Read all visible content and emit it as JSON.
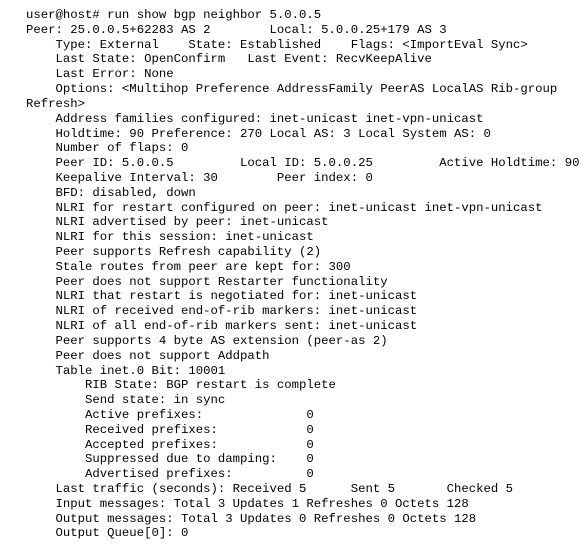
{
  "terminal": {
    "background_color": "#ffffff",
    "foreground_color": "#000000",
    "prompt": "user@host#",
    "command": "run show bgp neighbor 5.0.0.5",
    "command_line": "user@host# run show bgp neighbor 5.0.0.5",
    "columns": 79,
    "rows": 37
  },
  "output": {
    "peer_address": "25.0.0.5",
    "peer_port": "62283",
    "peer_as": "2",
    "local_address": "5.0.0.25",
    "local_port": "179",
    "local_as": "3",
    "type": "External",
    "state": "Established",
    "flags": "<ImportEval Sync>",
    "last_state": "OpenConfirm",
    "last_event": "RecvKeepAlive",
    "last_error": "None",
    "options": "<Multihop Preference AddressFamily PeerAS LocalAS Rib-group Refresh>",
    "address_families_configured": "inet-unicast inet-vpn-unicast",
    "holdtime": "90",
    "preference": "270",
    "local_as_value": "3",
    "local_system_as": "0",
    "number_of_flaps": "0",
    "peer_id": "5.0.0.5",
    "local_id": "5.0.0.25",
    "active_holdtime": "90",
    "keepalive_interval": "30",
    "peer_index": "0",
    "bfd": "disabled, down",
    "nlri_restart_configured": "inet-unicast inet-vpn-unicast",
    "nlri_advertised_by_peer": "inet-unicast",
    "nlri_this_session": "inet-unicast",
    "refresh_capability": "(2)",
    "stale_routes_kept_for": "300",
    "restarter_support": "Peer does not support Restarter functionality",
    "nlri_restart_negotiated": "inet-unicast",
    "nlri_received_eor": "inet-unicast",
    "nlri_all_eor_sent": "inet-unicast",
    "four_byte_as": "(peer-as 2)",
    "addpath_support": "Peer does not support Addpath",
    "table_name": "inet.0",
    "table_bit": "10001",
    "rib_state": "BGP restart is complete",
    "send_state": "in sync",
    "active_prefixes": "0",
    "received_prefixes": "0",
    "accepted_prefixes": "0",
    "suppressed_due_to_damping": "0",
    "advertised_prefixes": "0",
    "last_traffic_received": "5",
    "last_traffic_sent": "5",
    "last_traffic_checked": "5",
    "input_total": "3",
    "input_updates": "1",
    "input_refreshes": "0",
    "input_octets": "128",
    "output_total": "3",
    "output_updates": "0",
    "output_refreshes": "0",
    "output_octets": "128",
    "output_queue_index": "0",
    "output_queue_value": "0"
  },
  "lines": [
    "user@host# run show bgp neighbor 5.0.0.5",
    "Peer: 25.0.0.5+62283 AS 2        Local: 5.0.0.25+179 AS 3",
    "    Type: External    State: Established    Flags: <ImportEval Sync>",
    "    Last State: OpenConfirm   Last Event: RecvKeepAlive",
    "    Last Error: None",
    "    Options: <Multihop Preference AddressFamily PeerAS LocalAS Rib-group",
    "Refresh>",
    "    Address families configured: inet-unicast inet-vpn-unicast",
    "    Holdtime: 90 Preference: 270 Local AS: 3 Local System AS: 0",
    "    Number of flaps: 0",
    "    Peer ID: 5.0.0.5         Local ID: 5.0.0.25         Active Holdtime: 90",
    "    Keepalive Interval: 30        Peer index: 0",
    "    BFD: disabled, down",
    "    NLRI for restart configured on peer: inet-unicast inet-vpn-unicast",
    "    NLRI advertised by peer: inet-unicast",
    "    NLRI for this session: inet-unicast",
    "    Peer supports Refresh capability (2)",
    "    Stale routes from peer are kept for: 300",
    "    Peer does not support Restarter functionality",
    "    NLRI that restart is negotiated for: inet-unicast",
    "    NLRI of received end-of-rib markers: inet-unicast",
    "    NLRI of all end-of-rib markers sent: inet-unicast",
    "    Peer supports 4 byte AS extension (peer-as 2)",
    "    Peer does not support Addpath",
    "    Table inet.0 Bit: 10001",
    "        RIB State: BGP restart is complete",
    "        Send state: in sync",
    "        Active prefixes:              0",
    "        Received prefixes:            0",
    "        Accepted prefixes:            0",
    "        Suppressed due to damping:    0",
    "        Advertised prefixes:          0",
    "    Last traffic (seconds): Received 5      Sent 5       Checked 5",
    "    Input messages: Total 3 Updates 1 Refreshes 0 Octets 128",
    "    Output messages: Total 3 Updates 0 Refreshes 0 Octets 128",
    "    Output Queue[0]: 0"
  ]
}
